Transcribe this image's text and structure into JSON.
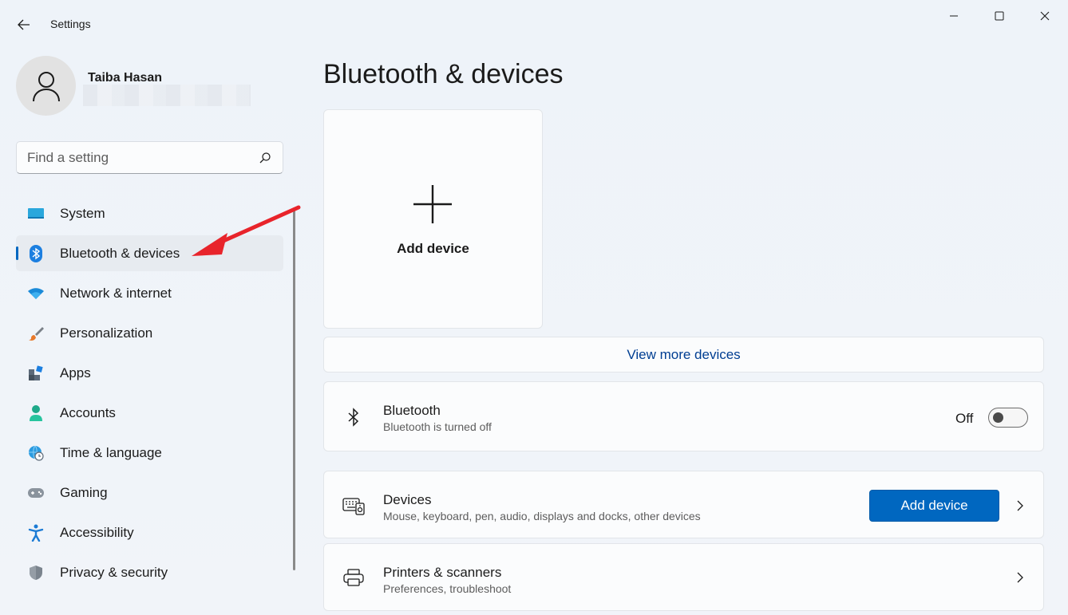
{
  "window": {
    "title": "Settings",
    "minimize_icon": "minimize-icon",
    "maximize_icon": "maximize-icon",
    "close_icon": "close-icon"
  },
  "profile": {
    "name": "Taiba Hasan"
  },
  "search": {
    "placeholder": "Find a setting"
  },
  "nav": {
    "items": [
      {
        "label": "System",
        "icon": "system-icon",
        "active": false
      },
      {
        "label": "Bluetooth & devices",
        "icon": "bluetooth-icon",
        "active": true
      },
      {
        "label": "Network & internet",
        "icon": "wifi-icon",
        "active": false
      },
      {
        "label": "Personalization",
        "icon": "brush-icon",
        "active": false
      },
      {
        "label": "Apps",
        "icon": "apps-icon",
        "active": false
      },
      {
        "label": "Accounts",
        "icon": "accounts-icon",
        "active": false
      },
      {
        "label": "Time & language",
        "icon": "globe-clock-icon",
        "active": false
      },
      {
        "label": "Gaming",
        "icon": "gamepad-icon",
        "active": false
      },
      {
        "label": "Accessibility",
        "icon": "accessibility-icon",
        "active": false
      },
      {
        "label": "Privacy & security",
        "icon": "shield-icon",
        "active": false
      }
    ]
  },
  "main": {
    "title": "Bluetooth & devices",
    "add_tile_label": "Add device",
    "view_more": "View more devices",
    "bluetooth": {
      "title": "Bluetooth",
      "subtitle": "Bluetooth is turned off",
      "state_label": "Off",
      "enabled": false
    },
    "devices": {
      "title": "Devices",
      "subtitle": "Mouse, keyboard, pen, audio, displays and docks, other devices",
      "button": "Add device"
    },
    "printers": {
      "title": "Printers & scanners",
      "subtitle": "Preferences, troubleshoot"
    }
  },
  "colors": {
    "accent": "#0067c0",
    "annotation_arrow": "#e8242b"
  }
}
